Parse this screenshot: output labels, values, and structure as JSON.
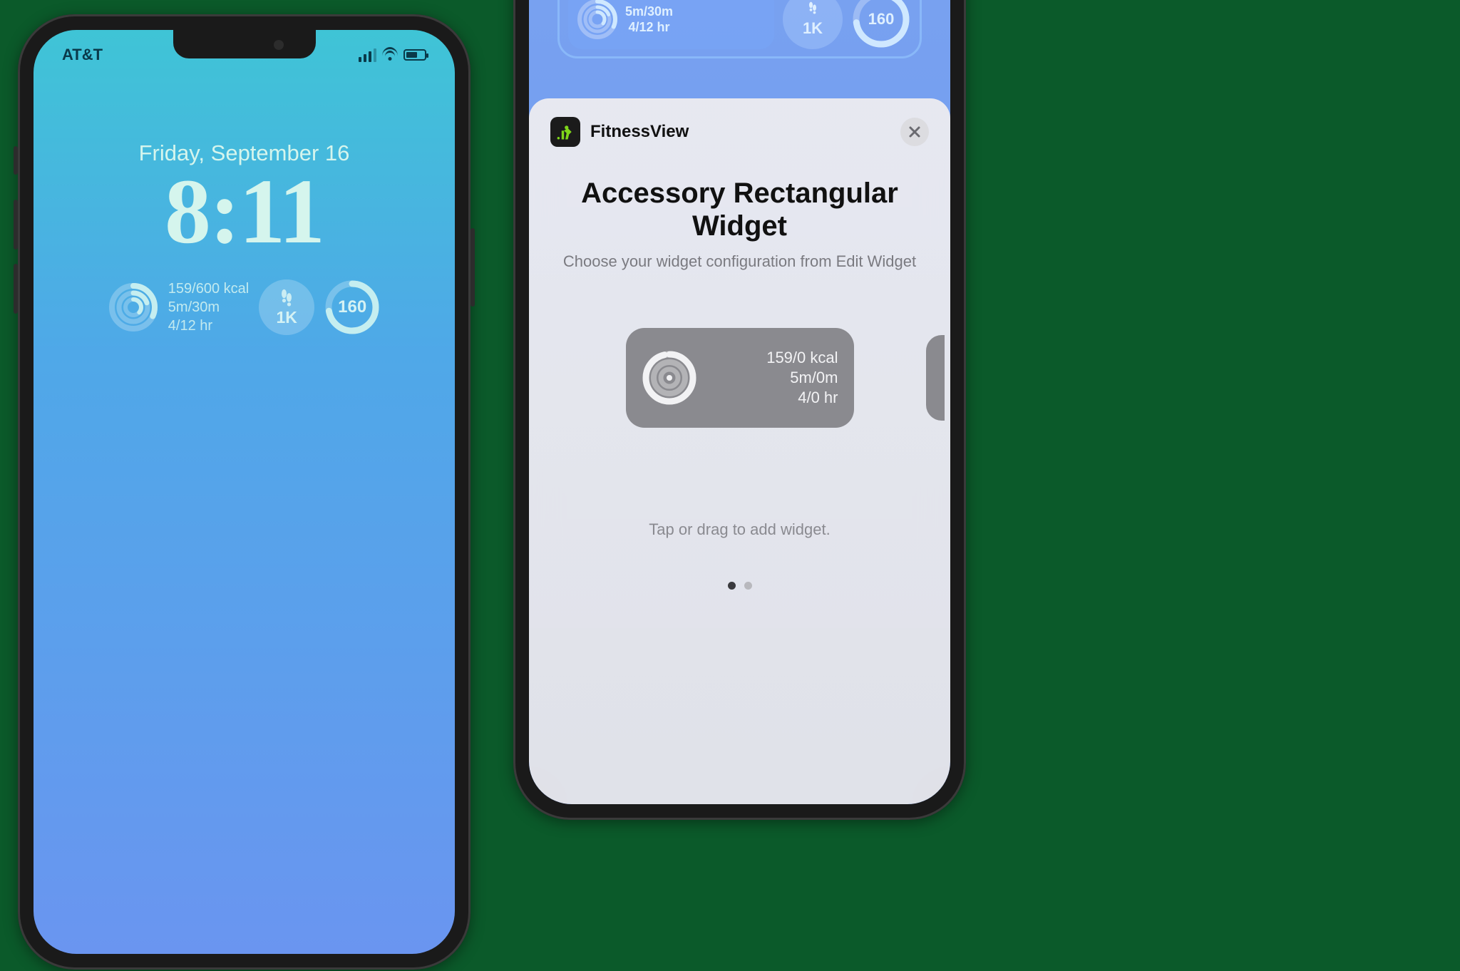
{
  "left": {
    "carrier": "AT&T",
    "date": "Friday, September 16",
    "time": "8:11",
    "widgets": {
      "rect": {
        "kcal": "159/600 kcal",
        "exercise": "5m/30m",
        "stand": "4/12 hr"
      },
      "steps": "1K",
      "heart": "160"
    }
  },
  "right": {
    "topRow": {
      "rect": {
        "exercise": "5m/30m",
        "stand": "4/12 hr"
      },
      "steps": "1K",
      "heart": "160"
    },
    "sheet": {
      "appName": "FitnessView",
      "title": "Accessory Rectangular Widget",
      "subtitle": "Choose your widget configuration from Edit Widget",
      "preview": {
        "kcal": "159/0 kcal",
        "exercise": "5m/0m",
        "stand": "4/0 hr"
      },
      "hint": "Tap or drag to add widget."
    }
  }
}
